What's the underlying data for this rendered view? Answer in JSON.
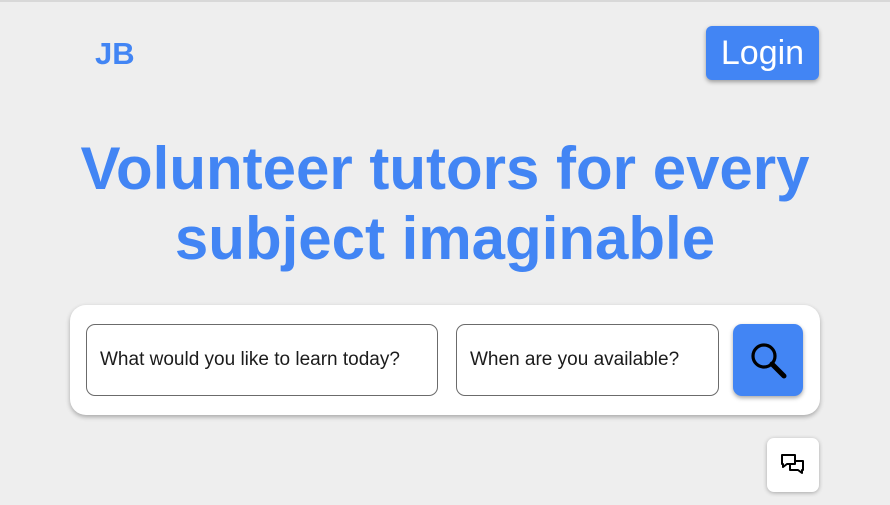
{
  "header": {
    "logo_text": "JB",
    "login_label": "Login"
  },
  "hero": {
    "line1": "Volunteer tutors for every",
    "line2": "subject imaginable"
  },
  "search": {
    "subject_placeholder": "What would you like to learn today?",
    "availability_placeholder": "When are you available?",
    "button_icon": "search-icon"
  },
  "chat": {
    "icon": "chat-icon"
  },
  "colors": {
    "accent": "#4285f4",
    "background": "#eeeeee",
    "card": "#ffffff"
  }
}
